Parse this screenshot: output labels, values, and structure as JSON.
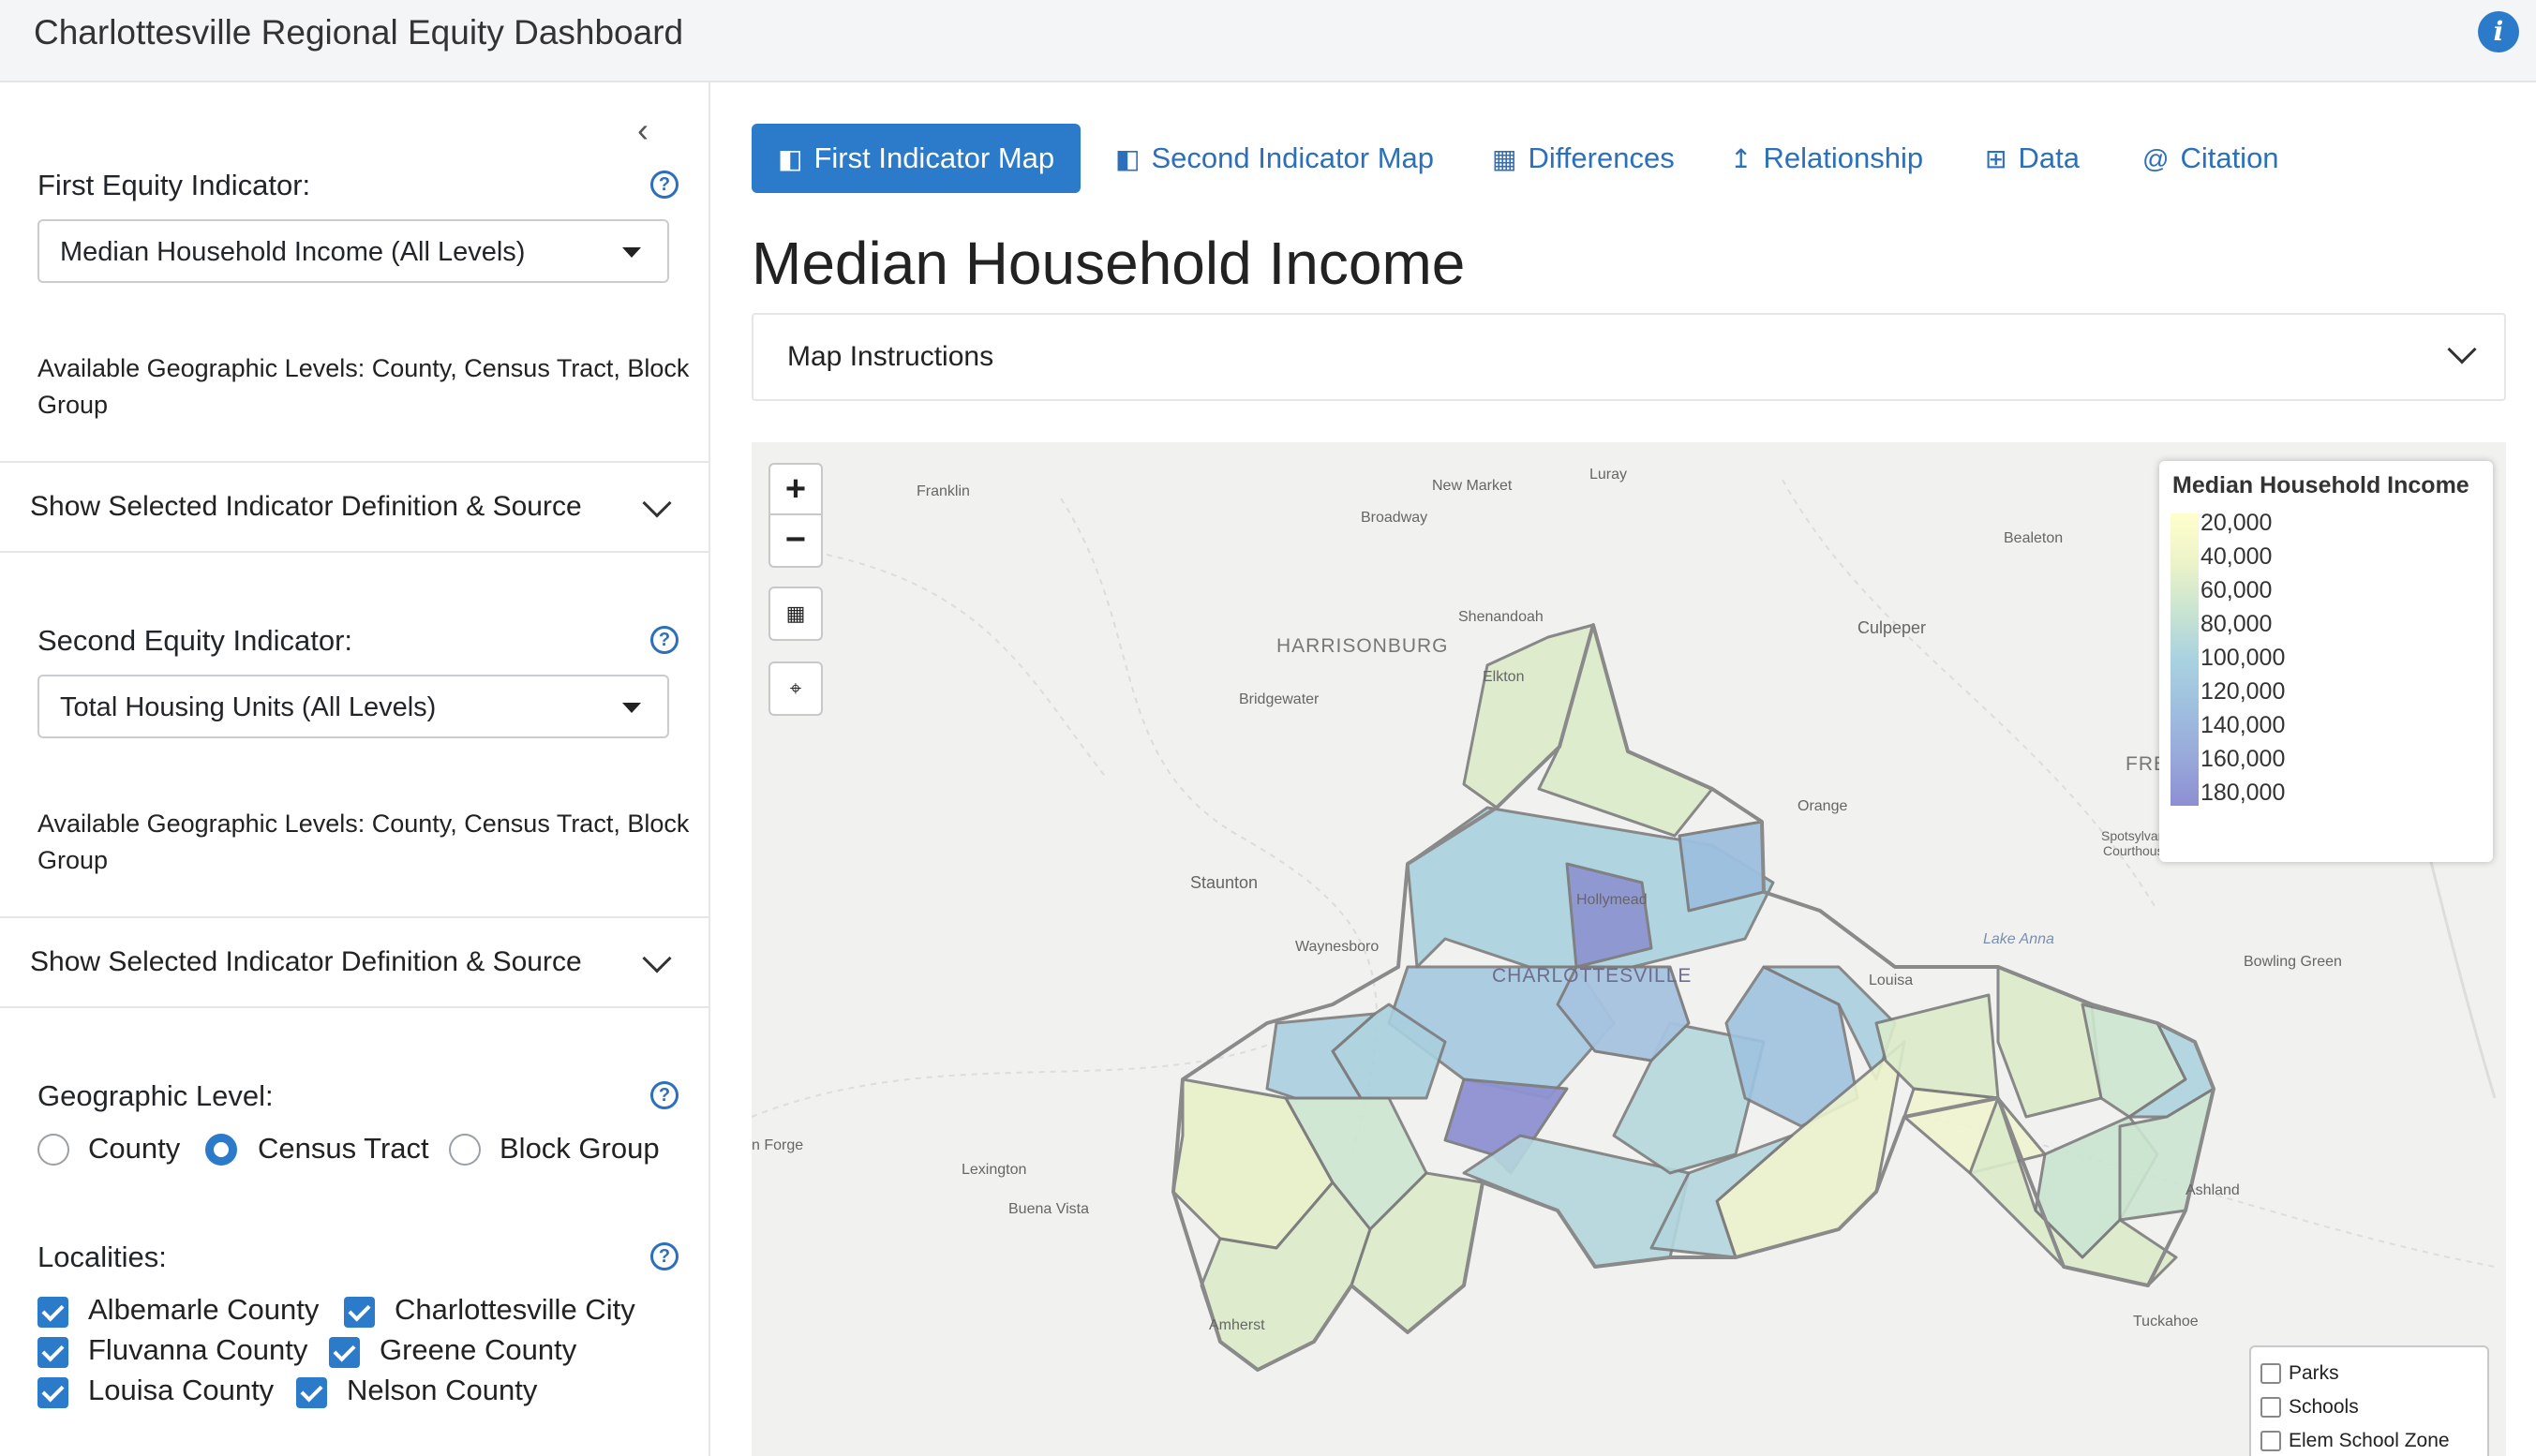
{
  "header": {
    "title": "Charlottesville Regional Equity Dashboard",
    "info_icon": "info-icon"
  },
  "sidebar": {
    "first_indicator": {
      "label": "First Equity Indicator:",
      "selected": "Median Household Income (All Levels)",
      "available": "Available Geographic Levels: County, Census Tract, Block Group",
      "accordion": "Show Selected Indicator Definition & Source"
    },
    "second_indicator": {
      "label": "Second Equity Indicator:",
      "selected": "Total Housing Units (All Levels)",
      "available": "Available Geographic Levels: County, Census Tract, Block Group",
      "accordion": "Show Selected Indicator Definition & Source"
    },
    "geo_level": {
      "label": "Geographic Level:",
      "options": [
        "County",
        "Census Tract",
        "Block Group"
      ],
      "selected": "Census Tract"
    },
    "localities": {
      "label": "Localities:",
      "items": [
        {
          "label": "Albemarle County",
          "checked": true
        },
        {
          "label": "Charlottesville City",
          "checked": true
        },
        {
          "label": "Fluvanna County",
          "checked": true
        },
        {
          "label": "Greene County",
          "checked": true
        },
        {
          "label": "Louisa County",
          "checked": true
        },
        {
          "label": "Nelson County",
          "checked": true
        }
      ]
    }
  },
  "main": {
    "tabs": [
      {
        "label": "First Indicator Map",
        "icon": "map-icon",
        "active": true
      },
      {
        "label": "Second Indicator Map",
        "icon": "map-icon",
        "active": false
      },
      {
        "label": "Differences",
        "icon": "bar-chart-icon",
        "active": false
      },
      {
        "label": "Relationship",
        "icon": "line-chart-icon",
        "active": false
      },
      {
        "label": "Data",
        "icon": "table-icon",
        "active": false
      },
      {
        "label": "Citation",
        "icon": "at-icon",
        "active": false
      }
    ],
    "page_title": "Median Household Income",
    "instructions_label": "Map Instructions"
  },
  "map": {
    "legend_title": "Median Household Income",
    "legend_ticks": [
      "20,000",
      "40,000",
      "60,000",
      "80,000",
      "100,000",
      "120,000",
      "140,000",
      "160,000",
      "180,000"
    ],
    "overlays": [
      "Parks",
      "Schools",
      "Elem School Zone"
    ],
    "places": {
      "franklin": "Franklin",
      "new_market": "New Market",
      "luray": "Luray",
      "broadway": "Broadway",
      "bealeton": "Bealeton",
      "shenandoah": "Shenandoah",
      "harrisonburg": "HARRISONBURG",
      "culpeper": "Culpeper",
      "elkton": "Elkton",
      "bridgewater": "Bridgewater",
      "orange": "Orange",
      "staunton": "Staunton",
      "spotsylvania": "Spotsylvania",
      "courthouse": "Courthouse",
      "waynesboro": "Waynesboro",
      "hollymead": "Hollymead",
      "lake_anna": "Lake Anna",
      "charlottesville": "CHARLOTTESVILLE",
      "louisa": "Louisa",
      "bowling_green": "Bowling Green",
      "iron_forge": "n Forge",
      "lexington": "Lexington",
      "buena_vista": "Buena Vista",
      "ashland": "Ashland",
      "amherst": "Amherst",
      "tuckahoe": "Tuckahoe",
      "fredericksburg": "FREDERICKSBURG"
    }
  },
  "colors": {
    "accent": "#2c7bca",
    "legend_low": "#ffffcc",
    "legend_high": "#8c8fd2"
  }
}
